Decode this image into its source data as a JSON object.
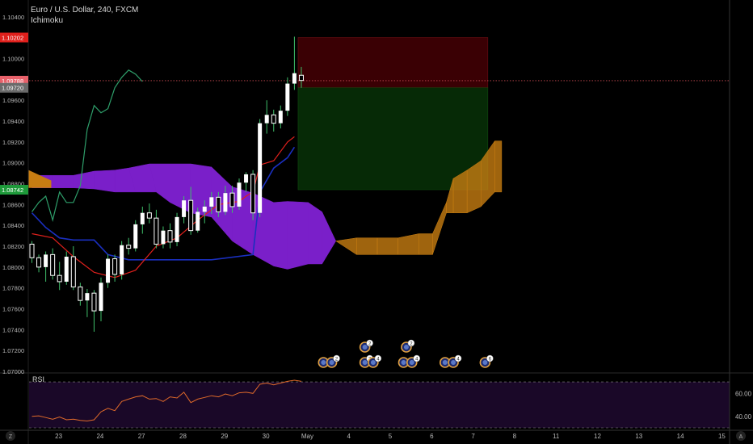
{
  "header": {
    "symbol_line": "Euro / U.S. Dollar, 240, FXCM",
    "indicator": "Ichimoku"
  },
  "rsi_label": "RSI",
  "footer_left_icon": "Z",
  "footer_right_icon": "A",
  "colors": {
    "bg": "#000000",
    "cloud_bear": "#7a1fc9",
    "cloud_bull": "#c77d12",
    "tenkan": "#e0201c",
    "kijun": "#1a2fbf",
    "chikou": "#2e9e6a",
    "rsi_line": "#e06a2a",
    "rsi_band": "#1a0828",
    "candle_up": "#ffffff",
    "candle_down": "#ffffff",
    "stop_zone": "#3a0004",
    "target_zone": "#062a06",
    "axis_text": "#b8b8b8",
    "tag_red": "#e0201c",
    "tag_salmon": "#e8616a",
    "tag_gray": "#6a6a6a",
    "tag_green": "#1e9a3a"
  },
  "chart_data": {
    "type": "candlestick",
    "x_ticks": [
      {
        "label": "23",
        "t": 2
      },
      {
        "label": "24",
        "t": 8
      },
      {
        "label": "27",
        "t": 14
      },
      {
        "label": "28",
        "t": 20
      },
      {
        "label": "29",
        "t": 26
      },
      {
        "label": "30",
        "t": 32
      },
      {
        "label": "May",
        "t": 38
      },
      {
        "label": "4",
        "t": 44
      },
      {
        "label": "5",
        "t": 50
      },
      {
        "label": "6",
        "t": 56
      },
      {
        "label": "7",
        "t": 62
      },
      {
        "label": "8",
        "t": 68
      },
      {
        "label": "11",
        "t": 74
      },
      {
        "label": "12",
        "t": 80
      },
      {
        "label": "13",
        "t": 86
      },
      {
        "label": "14",
        "t": 92
      },
      {
        "label": "15",
        "t": 98
      }
    ],
    "ylim": [
      1.07,
      1.105
    ],
    "y_ticks": [
      1.07,
      1.072,
      1.074,
      1.076,
      1.078,
      1.08,
      1.082,
      1.084,
      1.086,
      1.088,
      1.09,
      1.092,
      1.094,
      1.096,
      1.098,
      1.1,
      1.102,
      1.104
    ],
    "price_tags": [
      {
        "label": "1.10202",
        "value": 1.10202,
        "color": "tag_red"
      },
      {
        "label": "1.09788",
        "value": 1.09788,
        "color": "tag_salmon"
      },
      {
        "label": "1.09720",
        "value": 1.0972,
        "color": "tag_gray"
      },
      {
        "label": "1.08742",
        "value": 1.08742,
        "color": "tag_green"
      }
    ],
    "current_price": 1.09788,
    "position": {
      "entry": 1.0972,
      "stop": 1.10202,
      "target": 1.08742,
      "t_start": 39,
      "t_end": 66
    },
    "candles": [
      [
        0,
        1.0822,
        1.0825,
        1.0804,
        1.0809
      ],
      [
        1,
        1.0809,
        1.0812,
        1.0795,
        1.08
      ],
      [
        2,
        1.08,
        1.0815,
        1.0786,
        1.0812
      ],
      [
        3,
        1.0812,
        1.0818,
        1.0788,
        1.0792
      ],
      [
        4,
        1.0792,
        1.0805,
        1.0778,
        1.0786
      ],
      [
        5,
        1.0786,
        1.0815,
        1.0783,
        1.081
      ],
      [
        6,
        1.081,
        1.082,
        1.0778,
        1.0781
      ],
      [
        7,
        1.0781,
        1.0785,
        1.0763,
        1.0768
      ],
      [
        8,
        1.0768,
        1.0779,
        1.0752,
        1.0775
      ],
      [
        9,
        1.0775,
        1.0778,
        1.0738,
        1.0758
      ],
      [
        10,
        1.0758,
        1.079,
        1.0748,
        1.0785
      ],
      [
        11,
        1.0785,
        1.0812,
        1.078,
        1.0808
      ],
      [
        12,
        1.0808,
        1.0812,
        1.0786,
        1.0793
      ],
      [
        13,
        1.0793,
        1.0825,
        1.0788,
        1.0821
      ],
      [
        14,
        1.0821,
        1.0828,
        1.0812,
        1.0818
      ],
      [
        15,
        1.0818,
        1.0845,
        1.0815,
        1.0841
      ],
      [
        16,
        1.0841,
        1.0858,
        1.0832,
        1.0852
      ],
      [
        17,
        1.0852,
        1.0861,
        1.0842,
        1.0847
      ],
      [
        18,
        1.0847,
        1.0855,
        1.0818,
        1.0822
      ],
      [
        19,
        1.0822,
        1.0839,
        1.0818,
        1.0835
      ],
      [
        20,
        1.0835,
        1.0842,
        1.0818,
        1.0824
      ],
      [
        21,
        1.0824,
        1.0852,
        1.082,
        1.0848
      ],
      [
        22,
        1.0848,
        1.0868,
        1.0842,
        1.0864
      ],
      [
        23,
        1.0864,
        1.0877,
        1.0831,
        1.0835
      ],
      [
        24,
        1.0835,
        1.0857,
        1.0833,
        1.0853
      ],
      [
        25,
        1.0853,
        1.0864,
        1.0842,
        1.0858
      ],
      [
        26,
        1.0858,
        1.0872,
        1.0851,
        1.0867
      ],
      [
        27,
        1.0867,
        1.0872,
        1.0848,
        1.0853
      ],
      [
        28,
        1.0853,
        1.0878,
        1.085,
        1.0871
      ],
      [
        29,
        1.0871,
        1.0878,
        1.0852,
        1.0858
      ],
      [
        30,
        1.0858,
        1.0885,
        1.0855,
        1.0881
      ],
      [
        31,
        1.0881,
        1.0891,
        1.0872,
        1.0889
      ],
      [
        32,
        1.0889,
        1.0893,
        1.0845,
        1.0852
      ],
      [
        33,
        1.0852,
        1.0942,
        1.0848,
        1.0938
      ],
      [
        34,
        1.0938,
        1.096,
        1.0928,
        1.0946
      ],
      [
        35,
        1.0946,
        1.0951,
        1.093,
        1.0938
      ],
      [
        36,
        1.0938,
        1.0955,
        1.0933,
        1.095
      ],
      [
        37,
        1.095,
        1.0982,
        1.0945,
        1.0976
      ],
      [
        38,
        1.0976,
        1.1021,
        1.097,
        1.0986
      ],
      [
        39,
        1.0984,
        1.0992,
        1.0972,
        1.0979
      ]
    ],
    "tenkan": [
      [
        0,
        1.0832
      ],
      [
        3,
        1.0828
      ],
      [
        6,
        1.081
      ],
      [
        9,
        1.0795
      ],
      [
        12,
        1.079
      ],
      [
        15,
        1.0797
      ],
      [
        18,
        1.082
      ],
      [
        21,
        1.0828
      ],
      [
        24,
        1.0845
      ],
      [
        27,
        1.086
      ],
      [
        30,
        1.0863
      ],
      [
        31,
        1.0868
      ],
      [
        32,
        1.0872
      ],
      [
        33,
        1.0898
      ],
      [
        35,
        1.0902
      ],
      [
        37,
        1.092
      ],
      [
        38,
        1.0925
      ]
    ],
    "kijun": [
      [
        0,
        1.0852
      ],
      [
        2,
        1.0838
      ],
      [
        4,
        1.0828
      ],
      [
        6,
        1.0826
      ],
      [
        9,
        1.0826
      ],
      [
        11,
        1.0812
      ],
      [
        14,
        1.0807
      ],
      [
        20,
        1.0807
      ],
      [
        26,
        1.0807
      ],
      [
        32,
        1.0812
      ],
      [
        33,
        1.0872
      ],
      [
        35,
        1.0895
      ],
      [
        37,
        1.0905
      ],
      [
        38,
        1.0915
      ]
    ],
    "chikou": [
      [
        0,
        1.0853
      ],
      [
        1,
        1.0862
      ],
      [
        2,
        1.0868
      ],
      [
        3,
        1.0845
      ],
      [
        4,
        1.0872
      ],
      [
        5,
        1.0862
      ],
      [
        6,
        1.0862
      ],
      [
        7,
        1.0878
      ],
      [
        8,
        1.0932
      ],
      [
        9,
        1.0955
      ],
      [
        10,
        1.0948
      ],
      [
        11,
        1.0952
      ],
      [
        12,
        1.0972
      ],
      [
        13,
        1.0982
      ],
      [
        14,
        1.0989
      ],
      [
        15,
        1.0985
      ],
      [
        16,
        1.0978
      ]
    ],
    "cloud_span_a": [
      [
        0,
        1.0888
      ],
      [
        3,
        1.0888
      ],
      [
        6,
        1.0888
      ],
      [
        9,
        1.0892
      ],
      [
        12,
        1.0893
      ],
      [
        14,
        1.0895
      ],
      [
        17,
        1.0899
      ],
      [
        20,
        1.0899
      ],
      [
        23,
        1.0899
      ],
      [
        26,
        1.0896
      ],
      [
        29,
        1.0877
      ],
      [
        32,
        1.0871
      ],
      [
        35,
        1.0862
      ],
      [
        37,
        1.0863
      ],
      [
        40,
        1.0862
      ],
      [
        42,
        1.0853
      ],
      [
        44,
        1.0825
      ],
      [
        47,
        1.0828
      ],
      [
        50,
        1.0828
      ],
      [
        53,
        1.0828
      ],
      [
        56,
        1.0832
      ],
      [
        58,
        1.0832
      ],
      [
        60,
        1.0862
      ],
      [
        61,
        1.0885
      ],
      [
        63,
        1.0893
      ],
      [
        65,
        1.0902
      ],
      [
        67,
        1.0921
      ],
      [
        68,
        1.0921
      ]
    ],
    "cloud_span_b": [
      [
        0,
        1.0876
      ],
      [
        3,
        1.0876
      ],
      [
        6,
        1.0876
      ],
      [
        9,
        1.0875
      ],
      [
        12,
        1.0872
      ],
      [
        15,
        1.0872
      ],
      [
        18,
        1.0872
      ],
      [
        20,
        1.0862
      ],
      [
        23,
        1.0852
      ],
      [
        26,
        1.0848
      ],
      [
        29,
        1.0825
      ],
      [
        32,
        1.0812
      ],
      [
        35,
        1.0801
      ],
      [
        37,
        1.0798
      ],
      [
        40,
        1.0803
      ],
      [
        42,
        1.0803
      ],
      [
        44,
        1.0825
      ],
      [
        47,
        1.0812
      ],
      [
        50,
        1.0812
      ],
      [
        53,
        1.0812
      ],
      [
        56,
        1.0812
      ],
      [
        58,
        1.0812
      ],
      [
        60,
        1.0852
      ],
      [
        61,
        1.0852
      ],
      [
        63,
        1.0852
      ],
      [
        65,
        1.0858
      ],
      [
        67,
        1.0872
      ],
      [
        68,
        1.0872
      ]
    ],
    "rsi": {
      "label": "RSI",
      "ylim": [
        30,
        75
      ],
      "upper": 70,
      "lower": 30,
      "ticks": [
        {
          "label": "60.00",
          "value": 60
        },
        {
          "label": "40.00",
          "value": 40
        }
      ],
      "values": [
        [
          0,
          40
        ],
        [
          1,
          40.5
        ],
        [
          2,
          39
        ],
        [
          3,
          37.5
        ],
        [
          4,
          39.5
        ],
        [
          5,
          37
        ],
        [
          6,
          37.5
        ],
        [
          7,
          36.5
        ],
        [
          8,
          36
        ],
        [
          9,
          37
        ],
        [
          10,
          44
        ],
        [
          11,
          47
        ],
        [
          12,
          45
        ],
        [
          13,
          53
        ],
        [
          14,
          55
        ],
        [
          15,
          57
        ],
        [
          16,
          58
        ],
        [
          17,
          55
        ],
        [
          18,
          55.5
        ],
        [
          19,
          53
        ],
        [
          20,
          57
        ],
        [
          21,
          56
        ],
        [
          22,
          61
        ],
        [
          23,
          52
        ],
        [
          24,
          55
        ],
        [
          25,
          56.5
        ],
        [
          26,
          58
        ],
        [
          27,
          57
        ],
        [
          28,
          59.5
        ],
        [
          29,
          58
        ],
        [
          30,
          60.5
        ],
        [
          31,
          61
        ],
        [
          32,
          60
        ],
        [
          33,
          68
        ],
        [
          34,
          69
        ],
        [
          35,
          67.5
        ],
        [
          36,
          69
        ],
        [
          37,
          70.5
        ],
        [
          38,
          71.5
        ],
        [
          39,
          70.5
        ]
      ]
    },
    "events": [
      {
        "t": 42.2,
        "row": 0,
        "badge": ""
      },
      {
        "t": 43.4,
        "row": 0,
        "badge": "2"
      },
      {
        "t": 48.2,
        "row": 0,
        "badge": "2"
      },
      {
        "t": 49.4,
        "row": 0,
        "badge": "4"
      },
      {
        "t": 48.2,
        "row": 1,
        "badge": "2"
      },
      {
        "t": 53.8,
        "row": 0,
        "badge": ""
      },
      {
        "t": 55.0,
        "row": 0,
        "badge": "4"
      },
      {
        "t": 54.2,
        "row": 1,
        "badge": "2"
      },
      {
        "t": 59.8,
        "row": 0,
        "badge": ""
      },
      {
        "t": 61.0,
        "row": 0,
        "badge": "4"
      },
      {
        "t": 65.6,
        "row": 0,
        "badge": "6"
      }
    ]
  }
}
